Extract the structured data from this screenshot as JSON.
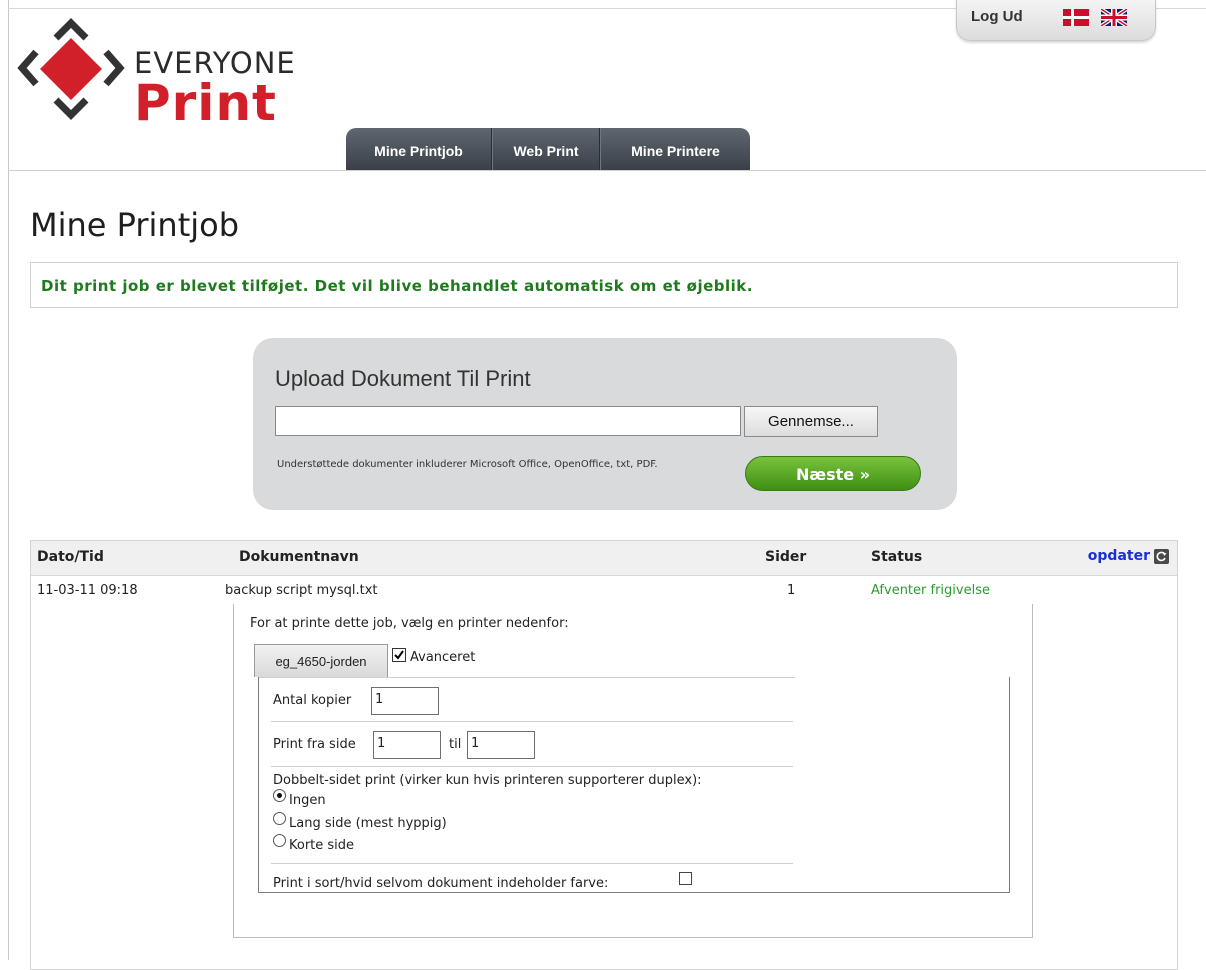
{
  "brand": {
    "line1": "EVERYONE",
    "line2": "Print"
  },
  "topbar": {
    "logout": "Log Ud",
    "lang_da": "flag-dk-icon",
    "lang_en": "flag-uk-icon"
  },
  "nav": {
    "tabs": [
      {
        "label": "Mine Printjob"
      },
      {
        "label": "Web Print"
      },
      {
        "label": "Mine Printere"
      }
    ]
  },
  "page": {
    "title": "Mine Printjob"
  },
  "notice": {
    "text": "Dit print job er blevet tilføjet. Det vil blive behandlet automatisk om et øjeblik."
  },
  "upload": {
    "title": "Upload Dokument Til Print",
    "file_value": "",
    "browse_label": "Gennemse...",
    "supported_text": "Understøttede dokumenter inkluderer Microsoft Office, OpenOffice, txt, PDF.",
    "next_label": "Næste »"
  },
  "table": {
    "headers": {
      "date": "Dato/Tid",
      "document": "Dokumentnavn",
      "pages": "Sider",
      "status": "Status"
    },
    "refresh_label": "opdater",
    "rows": [
      {
        "date": "11-03-11 09:18",
        "document": "backup script mysql.txt",
        "pages": "1",
        "status": "Afventer frigivelse"
      }
    ]
  },
  "job": {
    "hint": "For at printe dette job, vælg en printer nedenfor:",
    "printer_label": "eg_4650-jorden",
    "advanced_label": "Avanceret",
    "advanced_checked": true,
    "copies_label": "Antal kopier",
    "copies_value": "1",
    "print_from_label": "Print fra side",
    "print_from_value": "1",
    "to_label": "til",
    "print_to_value": "1",
    "duplex_label": "Dobbelt-sidet print (virker kun hvis printeren supporterer duplex):",
    "duplex_options": [
      {
        "label": "Ingen",
        "selected": true
      },
      {
        "label": "Lang side (mest hyppig)",
        "selected": false
      },
      {
        "label": "Korte side",
        "selected": false
      }
    ],
    "bw_label": "Print i sort/hvid selvom dokument indeholder farve:",
    "bw_checked": false
  },
  "colors": {
    "brand_red": "#d2202a",
    "notice_green": "#1f7a1f",
    "status_green": "#2e9a2e",
    "next_green": "#5aa82a",
    "link_blue": "#1a2fd8"
  }
}
